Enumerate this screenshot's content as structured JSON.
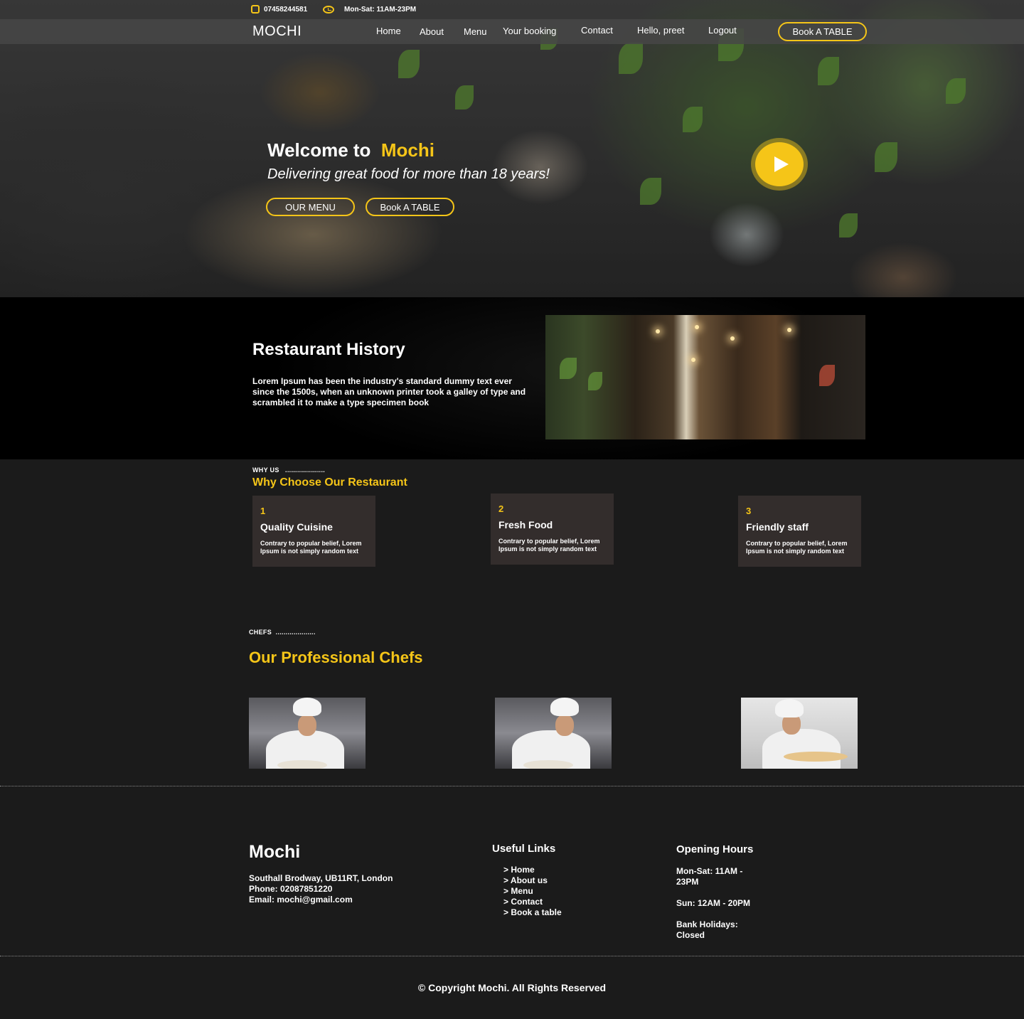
{
  "topbar": {
    "phone": "07458244581",
    "hours": "Mon-Sat: 11AM-23PM"
  },
  "nav": {
    "brand": "MOCHI",
    "links": [
      "Home",
      "About",
      "Menu",
      "Your booking",
      "Contact",
      "Hello, preet",
      "Logout"
    ],
    "cta": "Book A TABLE"
  },
  "hero": {
    "title_prefix": "Welcome to",
    "title_accent": "Mochi",
    "subtitle": "Delivering great food for more than 18 years!",
    "menu_button": "OUR MENU",
    "book_button": "Book A TABLE"
  },
  "history": {
    "title": "Restaurant History",
    "text": " Lorem Ipsum has been the industry's standard dummy text ever since the 1500s, when an unknown printer took a galley of type and scrambled it to make a type specimen book"
  },
  "why": {
    "label": "WHY US",
    "dots": "....................",
    "title": "Why Choose Our Restaurant",
    "cards": [
      {
        "num": "1",
        "title": "Quality Cuisine",
        "text": "Contrary to popular belief, Lorem Ipsum is not simply random text"
      },
      {
        "num": "2",
        "title": "Fresh Food",
        "text": "Contrary to popular belief, Lorem Ipsum is not simply random text"
      },
      {
        "num": "3",
        "title": "Friendly staff",
        "text": "Contrary to popular belief, Lorem Ipsum is not simply random text"
      }
    ]
  },
  "chefs": {
    "label": "CHEFS",
    "dots": "....................",
    "title": "Our Professional  Chefs"
  },
  "footer": {
    "brand": "Mochi",
    "address": "Southall Brodway, UB11RT, London",
    "phone": "Phone: 02087851220",
    "email": "Email: mochi@gmail.com",
    "links_title": "Useful Links",
    "links": [
      "> Home",
      "> About us",
      "> Menu",
      "> Contact",
      "> Book a table"
    ],
    "hours_title": "Opening Hours",
    "hours_weekday_1": "Mon-Sat: 11AM -",
    "hours_weekday_2": "23PM",
    "hours_sunday": "Sun: 12AM - 20PM",
    "hours_holiday_1": "Bank Holidays:",
    "hours_holiday_2": "Closed",
    "copyright": "© Copyright Mochi. All Rights Reserved"
  },
  "colors": {
    "accent": "#f5c518",
    "background": "#1b1b1b",
    "card": "#332d2c"
  }
}
